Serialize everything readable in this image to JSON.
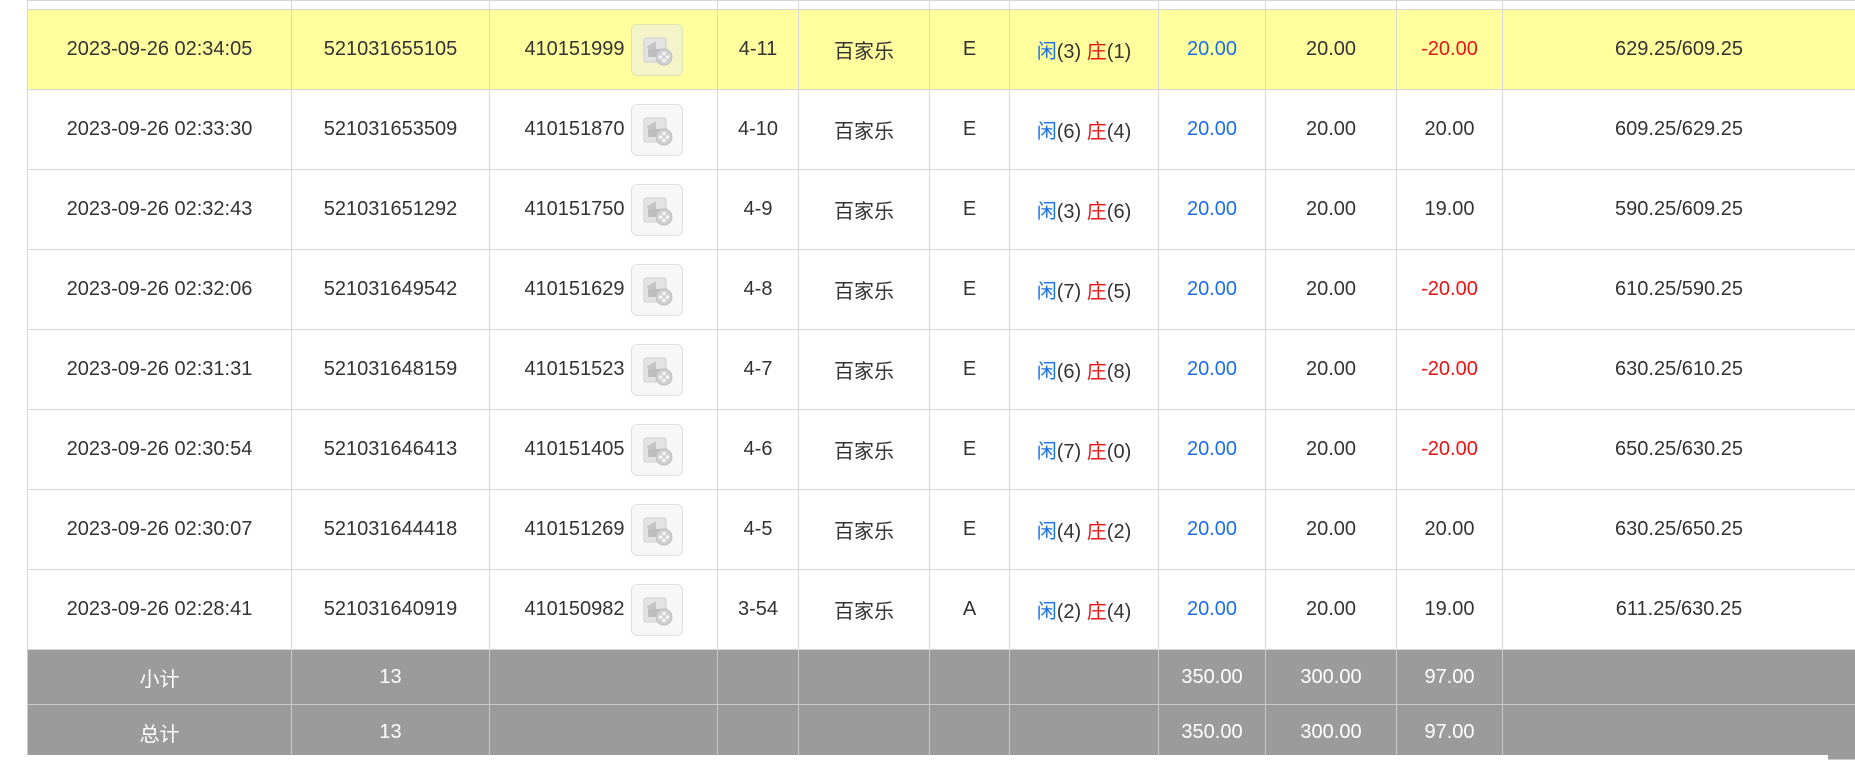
{
  "rows": [
    {
      "time": "2023-09-26 02:34:05",
      "order_id": "521031655105",
      "round_id": "410151999",
      "shoe": "4-11",
      "game": "百家乐",
      "table": "E",
      "result": {
        "player_label": "闲",
        "player_val": "(3)",
        "banker_label": "庄",
        "banker_val": "(1)"
      },
      "bet": "20.00",
      "valid_bet": "20.00",
      "win_loss": "-20.00",
      "balance": "629.25/609.25",
      "highlight": true
    },
    {
      "time": "2023-09-26 02:33:30",
      "order_id": "521031653509",
      "round_id": "410151870",
      "shoe": "4-10",
      "game": "百家乐",
      "table": "E",
      "result": {
        "player_label": "闲",
        "player_val": "(6)",
        "banker_label": "庄",
        "banker_val": "(4)"
      },
      "bet": "20.00",
      "valid_bet": "20.00",
      "win_loss": "20.00",
      "balance": "609.25/629.25",
      "highlight": false
    },
    {
      "time": "2023-09-26 02:32:43",
      "order_id": "521031651292",
      "round_id": "410151750",
      "shoe": "4-9",
      "game": "百家乐",
      "table": "E",
      "result": {
        "player_label": "闲",
        "player_val": "(3)",
        "banker_label": "庄",
        "banker_val": "(6)"
      },
      "bet": "20.00",
      "valid_bet": "20.00",
      "win_loss": "19.00",
      "balance": "590.25/609.25",
      "highlight": false
    },
    {
      "time": "2023-09-26 02:32:06",
      "order_id": "521031649542",
      "round_id": "410151629",
      "shoe": "4-8",
      "game": "百家乐",
      "table": "E",
      "result": {
        "player_label": "闲",
        "player_val": "(7)",
        "banker_label": "庄",
        "banker_val": "(5)"
      },
      "bet": "20.00",
      "valid_bet": "20.00",
      "win_loss": "-20.00",
      "balance": "610.25/590.25",
      "highlight": false
    },
    {
      "time": "2023-09-26 02:31:31",
      "order_id": "521031648159",
      "round_id": "410151523",
      "shoe": "4-7",
      "game": "百家乐",
      "table": "E",
      "result": {
        "player_label": "闲",
        "player_val": "(6)",
        "banker_label": "庄",
        "banker_val": "(8)"
      },
      "bet": "20.00",
      "valid_bet": "20.00",
      "win_loss": "-20.00",
      "balance": "630.25/610.25",
      "highlight": false
    },
    {
      "time": "2023-09-26 02:30:54",
      "order_id": "521031646413",
      "round_id": "410151405",
      "shoe": "4-6",
      "game": "百家乐",
      "table": "E",
      "result": {
        "player_label": "闲",
        "player_val": "(7)",
        "banker_label": "庄",
        "banker_val": "(0)"
      },
      "bet": "20.00",
      "valid_bet": "20.00",
      "win_loss": "-20.00",
      "balance": "650.25/630.25",
      "highlight": false
    },
    {
      "time": "2023-09-26 02:30:07",
      "order_id": "521031644418",
      "round_id": "410151269",
      "shoe": "4-5",
      "game": "百家乐",
      "table": "E",
      "result": {
        "player_label": "闲",
        "player_val": "(4)",
        "banker_label": "庄",
        "banker_val": "(2)"
      },
      "bet": "20.00",
      "valid_bet": "20.00",
      "win_loss": "20.00",
      "balance": "630.25/650.25",
      "highlight": false
    },
    {
      "time": "2023-09-26 02:28:41",
      "order_id": "521031640919",
      "round_id": "410150982",
      "shoe": "3-54",
      "game": "百家乐",
      "table": "A",
      "result": {
        "player_label": "闲",
        "player_val": "(2)",
        "banker_label": "庄",
        "banker_val": "(4)"
      },
      "bet": "20.00",
      "valid_bet": "20.00",
      "win_loss": "19.00",
      "balance": "611.25/630.25",
      "highlight": false
    }
  ],
  "subtotal": {
    "label": "小计",
    "count": "13",
    "bet": "350.00",
    "valid_bet": "300.00",
    "win_loss": "97.00"
  },
  "total": {
    "label": "总计",
    "count": "13",
    "bet": "350.00",
    "valid_bet": "300.00",
    "win_loss": "97.00"
  },
  "colors": {
    "highlight": "#ffff9e",
    "player": "#1a6ee8",
    "banker": "#e81414",
    "summary_bg": "#9b9b9b"
  },
  "icons": {
    "replay": "video-replay-icon"
  }
}
